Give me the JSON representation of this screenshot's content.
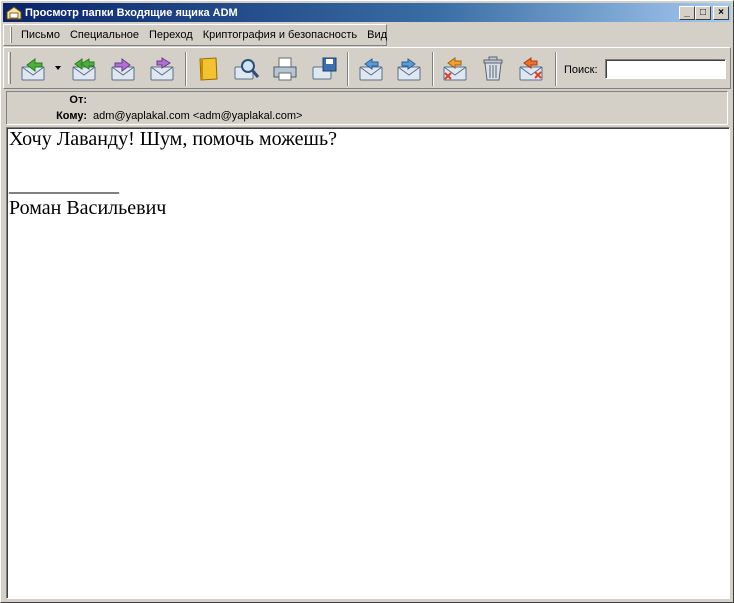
{
  "window": {
    "title": "Просмотр папки Входящие ящика ADM",
    "controls": {
      "minimize": "_",
      "maximize": "□",
      "close": "×"
    }
  },
  "menu": [
    {
      "label": "Письмо",
      "accesskey": "П"
    },
    {
      "label": "Специальное",
      "accesskey": "С"
    },
    {
      "label": "Переход",
      "accesskey": "П"
    },
    {
      "label": "Криптография и безопасность",
      "accesskey": "К"
    },
    {
      "label": "Вид",
      "accesskey": "В"
    }
  ],
  "toolbar": {
    "buttons": [
      "reply-icon",
      "reply-all-icon",
      "forward-icon",
      "redirect-icon",
      "address-book-icon",
      "find-icon",
      "print-icon",
      "save-icon",
      "previous-message-icon",
      "next-message-icon",
      "delete-icon",
      "trash-icon",
      "spam-icon"
    ],
    "search_label": "Поиск:",
    "search_value": ""
  },
  "headers": {
    "from_label": "От:",
    "from_value": "",
    "to_label": "Кому:",
    "to_value": "adm@yaplakal.com <adm@yaplakal.com>"
  },
  "message": {
    "line1": "Хочу Лаванду! Шум, помочь можешь?",
    "signature_rule": "___________",
    "signature": "Роман Васильевич"
  },
  "colors": {
    "titlebar_start": "#0a246a",
    "titlebar_end": "#a6caf0",
    "chrome": "#d4d0c8",
    "icon_green": "#4caf3a",
    "icon_purple": "#b070d0",
    "icon_blue": "#5a9bd5",
    "icon_red": "#e04020"
  }
}
